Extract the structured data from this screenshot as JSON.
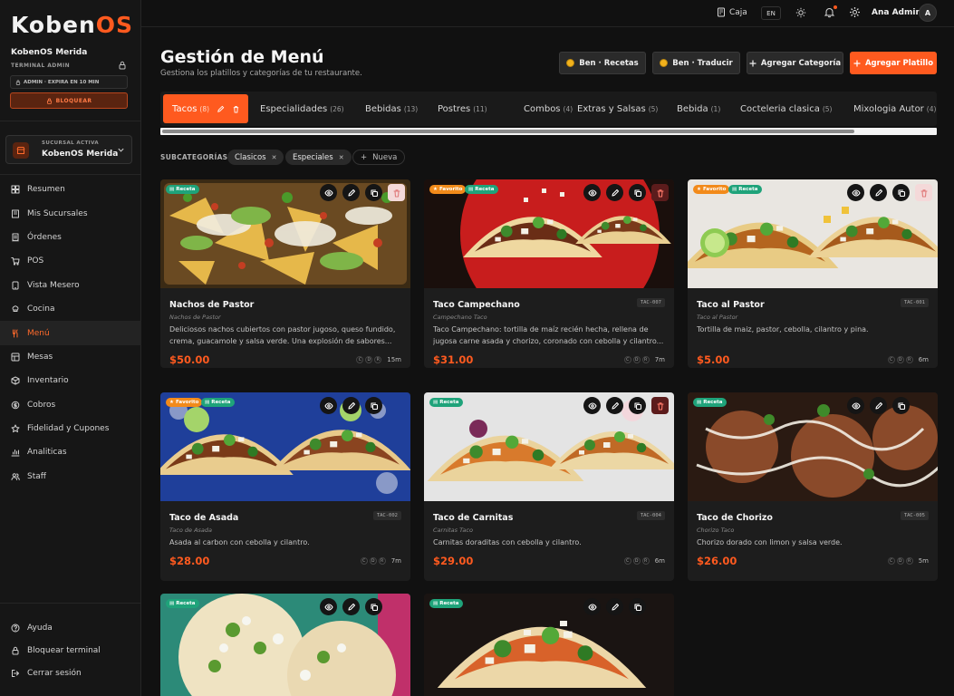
{
  "brand": {
    "name_main": "Koben",
    "name_accent": "OS"
  },
  "session": {
    "org": "KobenOS Merida",
    "terminal_label": "TERMINAL ADMIN",
    "expires": "ADMIN · EXPIRA EN 10 MIN",
    "block_label": "BLOQUEAR"
  },
  "branch": {
    "caption": "SUCURSAL ACTIVA",
    "name": "KobenOS Merida"
  },
  "nav": [
    {
      "label": "Resumen",
      "icon": "grid-icon"
    },
    {
      "label": "Mis Sucursales",
      "icon": "building-icon"
    },
    {
      "label": "Órdenes",
      "icon": "receipt-icon"
    },
    {
      "label": "POS",
      "icon": "cart-icon"
    },
    {
      "label": "Vista Mesero",
      "icon": "tablet-icon"
    },
    {
      "label": "Cocina",
      "icon": "chef-hat-icon"
    },
    {
      "label": "Menú",
      "icon": "utensils-icon",
      "active": true
    },
    {
      "label": "Mesas",
      "icon": "table-icon"
    },
    {
      "label": "Inventario",
      "icon": "box-icon"
    },
    {
      "label": "Cobros",
      "icon": "coin-icon"
    },
    {
      "label": "Fidelidad y Cupones",
      "icon": "star-icon"
    },
    {
      "label": "Analiticas",
      "icon": "chart-icon"
    },
    {
      "label": "Staff",
      "icon": "users-icon"
    }
  ],
  "footer_nav": [
    {
      "label": "Ayuda",
      "icon": "help-icon"
    },
    {
      "label": "Bloquear terminal",
      "icon": "lock-icon"
    },
    {
      "label": "Cerrar sesión",
      "icon": "logout-icon"
    }
  ],
  "topbar": {
    "caja": "Caja",
    "lang": "EN",
    "user": "Ana Admin",
    "avatar": "A"
  },
  "header": {
    "title": "Gestión de Menú",
    "subtitle": "Gestiona los platillos y categorías de tu restaurante.",
    "btn_recetas": "Ben · Recetas",
    "btn_traducir": "Ben · Traducir",
    "btn_categoria": "Agregar Categoría",
    "btn_platillo": "Agregar Platillo"
  },
  "tabs": [
    {
      "label": "Tacos",
      "count": "(8)"
    },
    {
      "label": "Especialidades",
      "count": "(26)"
    },
    {
      "label": "Bebidas",
      "count": "(13)"
    },
    {
      "label": "Postres",
      "count": "(11)"
    },
    {
      "label": "Combos",
      "count": "(4)"
    },
    {
      "label": "Extras y Salsas",
      "count": "(5)"
    },
    {
      "label": "Bebida",
      "count": "(1)"
    },
    {
      "label": "Cocteleria clasica",
      "count": "(5)"
    },
    {
      "label": "Mixologia Autor",
      "count": "(4)"
    }
  ],
  "subcategories": {
    "label": "SUBCATEGORÍAS:",
    "items": [
      "Clasicos",
      "Especiales"
    ],
    "new_label": "Nueva"
  },
  "badges": {
    "favorite": "Favorito",
    "recipe": "Receta"
  },
  "station_letters": [
    "C",
    "D",
    "R"
  ],
  "dishes": [
    {
      "name": "Nachos de Pastor",
      "alt": "Nachos de Pastor",
      "code": "",
      "desc": "Deliciosos nachos cubiertos con pastor jugoso, queso fundido, crema, guacamole y salsa verde. Una explosión de sabores...",
      "price": "$50.00",
      "time": "15m",
      "favorite": false,
      "recipe": true
    },
    {
      "name": "Taco Campechano",
      "alt": "Campechano Taco",
      "code": "TAC-007",
      "desc": "Taco Campechano: tortilla de maíz recién hecha, rellena de jugosa carne asada y chorizo, coronado con cebolla y cilantro...",
      "price": "$31.00",
      "time": "7m",
      "favorite": true,
      "recipe": true
    },
    {
      "name": "Taco al Pastor",
      "alt": "Taco al Pastor",
      "code": "TAC-001",
      "desc": "Tortilla de maiz, pastor, cebolla, cilantro y pina.",
      "price": "$5.00",
      "time": "6m",
      "favorite": true,
      "recipe": true
    },
    {
      "name": "Taco de Asada",
      "alt": "Taco de Asada",
      "code": "TAC-002",
      "desc": "Asada al carbon con cebolla y cilantro.",
      "price": "$28.00",
      "time": "7m",
      "favorite": true,
      "recipe": true
    },
    {
      "name": "Taco de Carnitas",
      "alt": "Carnitas Taco",
      "code": "TAC-004",
      "desc": "Carnitas doraditas con cebolla y cilantro.",
      "price": "$29.00",
      "time": "6m",
      "favorite": false,
      "recipe": true
    },
    {
      "name": "Taco de Chorizo",
      "alt": "Chorizo Taco",
      "code": "TAC-005",
      "desc": "Chorizo dorado con limon y salsa verde.",
      "price": "$26.00",
      "time": "5m",
      "favorite": false,
      "recipe": true
    },
    {
      "name": "",
      "alt": "",
      "code": "",
      "desc": "",
      "price": "",
      "time": "",
      "favorite": false,
      "recipe": true
    },
    {
      "name": "",
      "alt": "",
      "code": "",
      "desc": "",
      "price": "",
      "time": "",
      "favorite": false,
      "recipe": true
    }
  ],
  "colors": {
    "accent": "#ff5a1f",
    "background": "#111111",
    "card": "#1d1d1d",
    "recipe_badge": "#1fa37a",
    "favorite_badge": "#f28a1a"
  }
}
